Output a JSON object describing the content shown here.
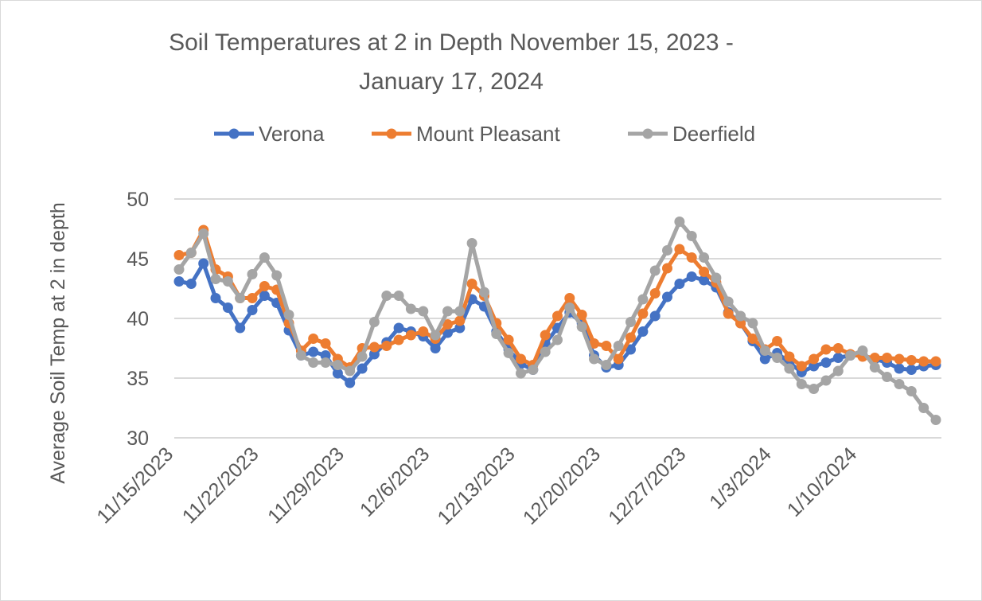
{
  "chart_data": {
    "type": "line",
    "title": "Soil Temperatures at 2 in Depth November 15, 2023 - January 17, 2024",
    "title_lines": [
      "Soil Temperatures at 2 in Depth November 15, 2023 -",
      "January 17, 2024"
    ],
    "xlabel": "",
    "ylabel": "Average Soil Temp at 2 in depth",
    "ylim": [
      30,
      50
    ],
    "yticks": [
      30,
      35,
      40,
      45,
      50
    ],
    "grid": true,
    "legend_position": "top",
    "x_start": "11/15/2023",
    "x_step": "1 day",
    "xtick_labels": [
      "11/15/2023",
      "11/22/2023",
      "11/29/2023",
      "12/6/2023",
      "12/13/2023",
      "12/20/2023",
      "12/27/2023",
      "1/3/2024",
      "1/10/2024"
    ],
    "xtick_every": 7,
    "series": [
      {
        "name": "Verona",
        "color": "#4472c4",
        "values": [
          43.1,
          42.9,
          44.6,
          41.7,
          40.9,
          39.2,
          40.7,
          41.9,
          41.3,
          39.0,
          36.9,
          37.2,
          36.9,
          35.4,
          34.6,
          35.8,
          37.0,
          38.0,
          39.2,
          38.9,
          38.5,
          37.5,
          38.8,
          39.2,
          41.6,
          41.0,
          38.9,
          37.4,
          36.2,
          35.7,
          37.9,
          39.2,
          40.5,
          39.6,
          36.9,
          35.9,
          36.1,
          37.4,
          38.9,
          40.2,
          41.8,
          42.9,
          43.5,
          43.2,
          42.6,
          40.5,
          39.6,
          38.1,
          36.6,
          37.1,
          36.3,
          35.5,
          36.0,
          36.3,
          36.7,
          36.9,
          36.9,
          36.6,
          36.3,
          35.8,
          35.7,
          36.0,
          36.1
        ]
      },
      {
        "name": "Mount Pleasant",
        "color": "#ed7d31",
        "values": [
          45.3,
          45.5,
          47.4,
          44.1,
          43.5,
          41.7,
          41.7,
          42.7,
          42.4,
          39.6,
          37.3,
          38.3,
          37.9,
          36.6,
          35.9,
          37.5,
          37.6,
          37.7,
          38.2,
          38.6,
          38.9,
          38.3,
          39.5,
          39.8,
          42.9,
          41.9,
          39.6,
          38.2,
          36.6,
          36.1,
          38.6,
          40.2,
          41.7,
          40.3,
          37.9,
          37.7,
          36.6,
          38.4,
          40.4,
          42.1,
          44.2,
          45.8,
          45.1,
          43.9,
          43.0,
          40.4,
          39.6,
          38.3,
          37.4,
          38.1,
          36.8,
          36.0,
          36.6,
          37.4,
          37.5,
          37.0,
          36.8,
          36.7,
          36.7,
          36.6,
          36.5,
          36.4,
          36.4
        ]
      },
      {
        "name": "Deerfield",
        "color": "#a5a5a5",
        "values": [
          44.1,
          45.5,
          47.1,
          43.3,
          43.1,
          41.7,
          43.7,
          45.1,
          43.6,
          40.3,
          36.9,
          36.3,
          36.3,
          36.1,
          35.6,
          36.8,
          39.7,
          41.9,
          41.9,
          40.8,
          40.6,
          38.6,
          40.6,
          40.6,
          46.3,
          42.2,
          38.7,
          37.1,
          35.4,
          35.7,
          37.2,
          38.2,
          40.9,
          39.3,
          36.6,
          36.1,
          37.7,
          39.7,
          41.6,
          44.0,
          45.7,
          48.1,
          46.9,
          45.1,
          43.4,
          41.4,
          40.2,
          39.6,
          37.3,
          36.7,
          35.8,
          34.5,
          34.1,
          34.8,
          35.6,
          36.9,
          37.3,
          35.9,
          35.1,
          34.5,
          33.9,
          32.5,
          31.5
        ]
      }
    ]
  }
}
